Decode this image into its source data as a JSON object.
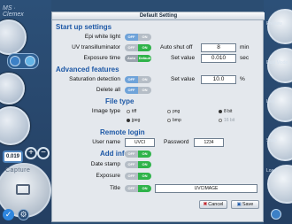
{
  "logo": {
    "line1": "MS ·",
    "line2": "Clemex"
  },
  "left_panel": {
    "zoom_value": "0.019",
    "capture_label": "Capture",
    "plus": "+",
    "minus": "−",
    "check": "✓",
    "gear": "⚙"
  },
  "right_panel": {
    "labels": [
      "Preview",
      "Dual Mode",
      "Live",
      "Snap",
      "Load"
    ]
  },
  "dialog": {
    "title": "Default Setting",
    "startup": {
      "heading": "Start up settings",
      "epi_label": "Epi white light",
      "uv_label": "UV transilluminator",
      "exposure_label": "Exposure time",
      "auto_shut_label": "Auto shut off",
      "auto_shut_value": "8",
      "auto_shut_unit": "min",
      "set_value_label": "Set value",
      "set_value": "0.010",
      "set_value_unit": "sec"
    },
    "advanced": {
      "heading": "Advanced features",
      "saturation_label": "Saturation detection",
      "delete_label": "Delete all",
      "set_value_label": "Set value",
      "set_value": "10.0",
      "set_value_unit": "%"
    },
    "filetype": {
      "heading": "File type",
      "image_type_label": "Image type",
      "options": [
        "tiff",
        "png",
        "8 bit",
        "jpeg",
        "bmp",
        "16 bit"
      ]
    },
    "remote": {
      "heading": "Remote login",
      "user_label": "User name",
      "user_value": "UVCI",
      "password_label": "Password",
      "password_value": "1234"
    },
    "addinfo": {
      "heading": "Add info",
      "datestamp_label": "Date stamp",
      "exposure_label": "Exposure",
      "title_label": "Title",
      "title_value": "UVCIMAGE"
    },
    "toggles": {
      "off": "OFF",
      "on": "ON",
      "auto": "Auto",
      "default": "Default"
    },
    "buttons": {
      "cancel": "Cancel",
      "save": "Save"
    }
  }
}
